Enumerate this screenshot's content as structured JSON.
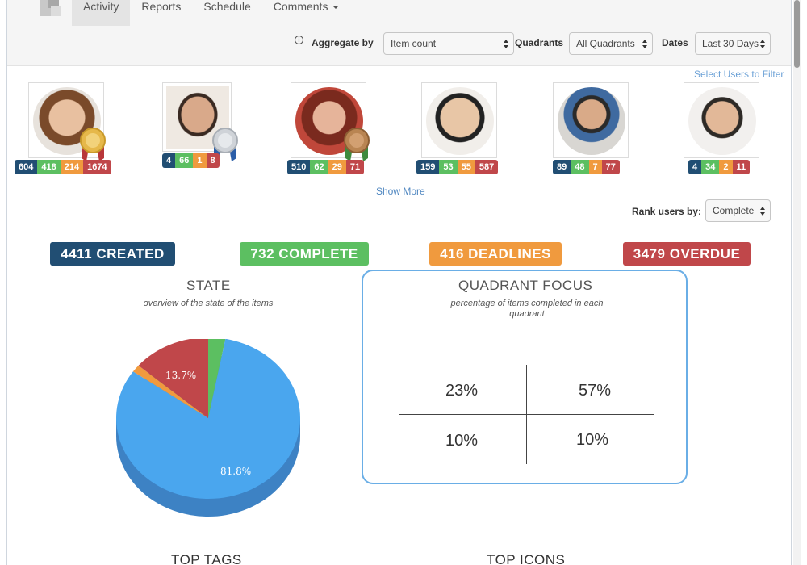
{
  "nav": {
    "tabs": [
      {
        "label": "Activity"
      },
      {
        "label": "Reports"
      },
      {
        "label": "Schedule"
      },
      {
        "label": "Comments"
      }
    ]
  },
  "filters": {
    "aggregate_label": "Aggregate by",
    "aggregate_value": "Item count",
    "quadrants_label": "Quadrants",
    "quadrants_value": "All Quadrants",
    "dates_label": "Dates",
    "dates_value": "Last 30 Days"
  },
  "users_link": "Select Users to Filter",
  "users": [
    {
      "medal": "gold",
      "stats": [
        "604",
        "418",
        "214",
        "1674"
      ]
    },
    {
      "medal": "silver",
      "stats": [
        "4",
        "66",
        "1",
        "8"
      ]
    },
    {
      "medal": "bronze",
      "stats": [
        "510",
        "62",
        "29",
        "71"
      ]
    },
    {
      "medal": "",
      "stats": [
        "159",
        "53",
        "55",
        "587"
      ]
    },
    {
      "medal": "",
      "stats": [
        "89",
        "48",
        "7",
        "77"
      ]
    },
    {
      "medal": "",
      "stats": [
        "4",
        "34",
        "2",
        "11"
      ]
    }
  ],
  "show_more": "Show More",
  "rank": {
    "label": "Rank users by:",
    "value": "Complete"
  },
  "stats": {
    "created": "4411 CREATED",
    "complete": "732 COMPLETE",
    "deadlines": "416 DEADLINES",
    "overdue": "3479 OVERDUE"
  },
  "colors": {
    "created": "#214e73",
    "complete": "#5cbf61",
    "deadlines": "#f09a3e",
    "overdue": "#c0474a",
    "pie_blue": "#4aa6ee",
    "pie_blue_side": "#3d82c4",
    "accent_link": "#4e86c0"
  },
  "state_section": {
    "title": "STATE",
    "subtitle": "overview of the state of the items",
    "pie": [
      {
        "name": "blue",
        "value": 81.8,
        "label": "81.8%"
      },
      {
        "name": "orange",
        "value": 1.5,
        "label": ""
      },
      {
        "name": "red",
        "value": 13.7,
        "label": "13.7%"
      },
      {
        "name": "green",
        "value": 3.0,
        "label": ""
      }
    ]
  },
  "quadrant_section": {
    "title": "QUADRANT FOCUS",
    "subtitle_line1": "percentage of items completed in each",
    "subtitle_line2": "quadrant",
    "values": {
      "top_left": "23%",
      "top_right": "57%",
      "bottom_left": "10%",
      "bottom_right": "10%"
    }
  },
  "bottom": {
    "tags_title": "TOP TAGS",
    "icons_title": "TOP ICONS"
  }
}
